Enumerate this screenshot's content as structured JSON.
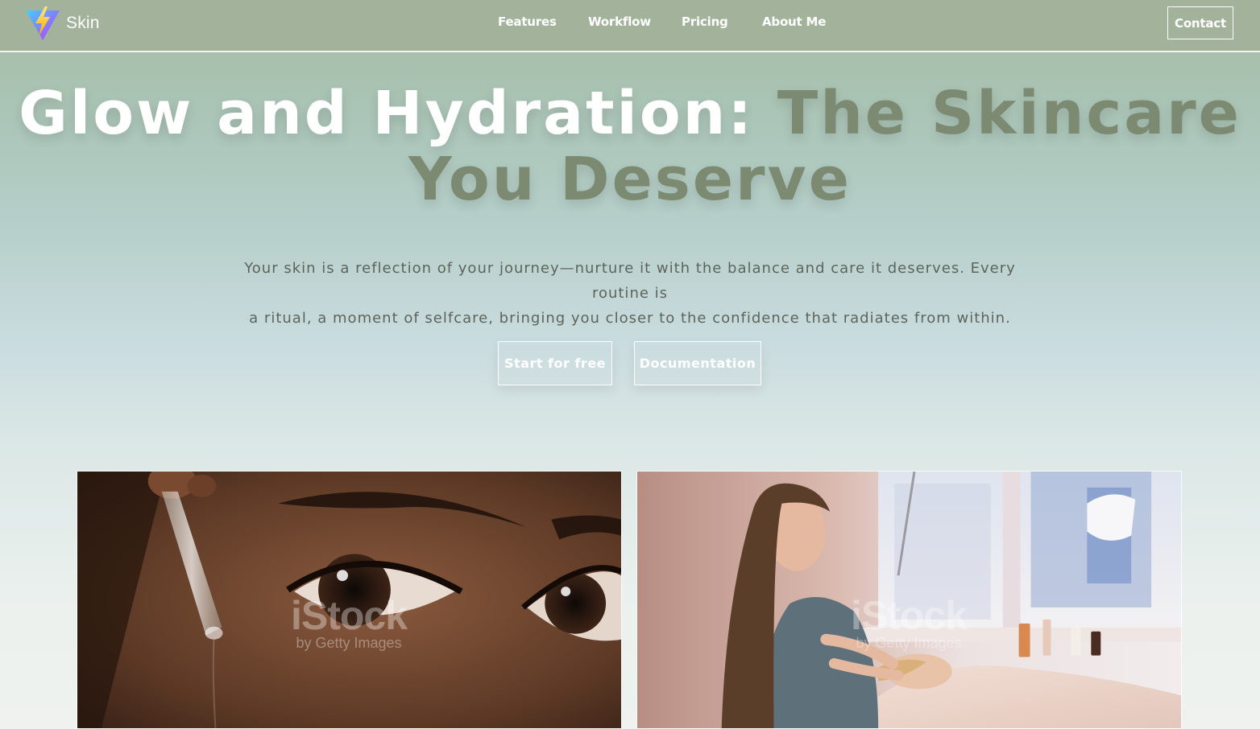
{
  "nav": {
    "brand": "Skin",
    "links": [
      "Features",
      "Workflow",
      "Pricing",
      "About Me"
    ],
    "contact": "Contact"
  },
  "hero": {
    "title_part1": "Glow and Hydration: ",
    "title_part2": "The Skincare You Deserve",
    "subtitle_line1": "Your skin is a reflection of your journey—nurture it with the balance and care it deserves. Every routine is",
    "subtitle_line2": "a ritual, a moment of selfcare, bringing you closer to the confidence that radiates from within.",
    "buttons": {
      "primary": "Start for free",
      "secondary": "Documentation"
    }
  },
  "media": {
    "watermark_main": "iStock",
    "watermark_sub": "by Getty Images"
  },
  "colors": {
    "nav_bg": "#a3b29b",
    "title_accent": "#7c8a72",
    "subtitle_text": "#5e6459"
  }
}
